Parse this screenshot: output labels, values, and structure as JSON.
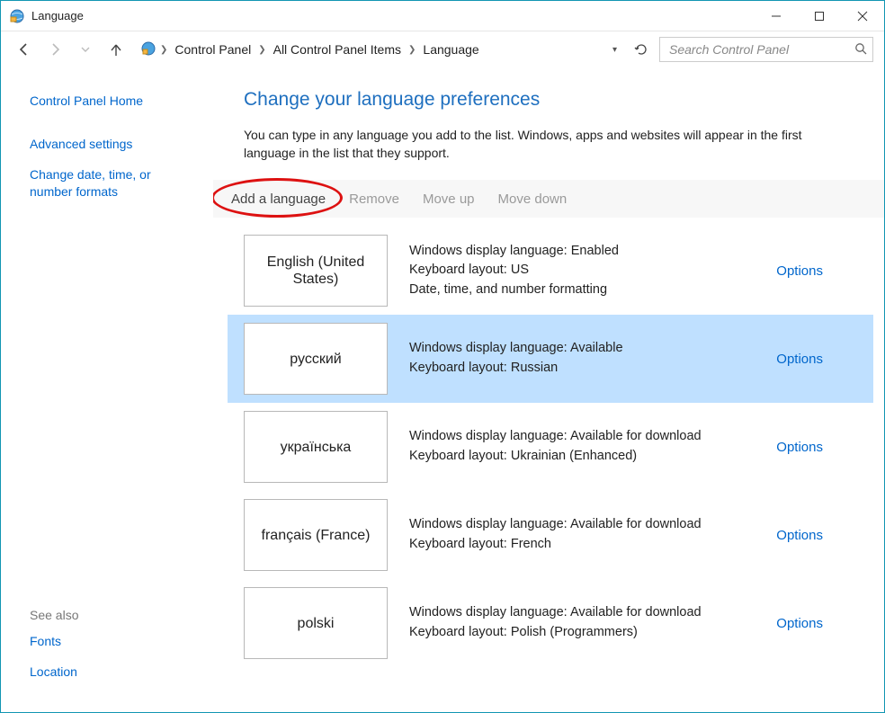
{
  "titlebar": {
    "title": "Language"
  },
  "breadcrumbs": [
    "Control Panel",
    "All Control Panel Items",
    "Language"
  ],
  "search": {
    "placeholder": "Search Control Panel"
  },
  "sidebar": {
    "home": "Control Panel Home",
    "links": [
      "Advanced settings",
      "Change date, time, or number formats"
    ],
    "see_also_label": "See also",
    "see_also": [
      "Fonts",
      "Location"
    ]
  },
  "main": {
    "heading": "Change your language preferences",
    "description": "You can type in any language you add to the list. Windows, apps and websites will appear in the first language in the list that they support.",
    "toolbar": {
      "add": "Add a language",
      "remove": "Remove",
      "move_up": "Move up",
      "move_down": "Move down"
    },
    "options_label": "Options",
    "languages": [
      {
        "tile": "English (United States)",
        "details": [
          "Windows display language: Enabled",
          "Keyboard layout: US",
          "Date, time, and number formatting"
        ],
        "selected": false
      },
      {
        "tile": "русский",
        "details": [
          "Windows display language: Available",
          "Keyboard layout: Russian"
        ],
        "selected": true
      },
      {
        "tile": "українська",
        "details": [
          "Windows display language: Available for download",
          "Keyboard layout: Ukrainian (Enhanced)"
        ],
        "selected": false
      },
      {
        "tile": "français (France)",
        "details": [
          "Windows display language: Available for download",
          "Keyboard layout: French"
        ],
        "selected": false
      },
      {
        "tile": "polski",
        "details": [
          "Windows display language: Available for download",
          "Keyboard layout: Polish (Programmers)"
        ],
        "selected": false
      }
    ]
  }
}
